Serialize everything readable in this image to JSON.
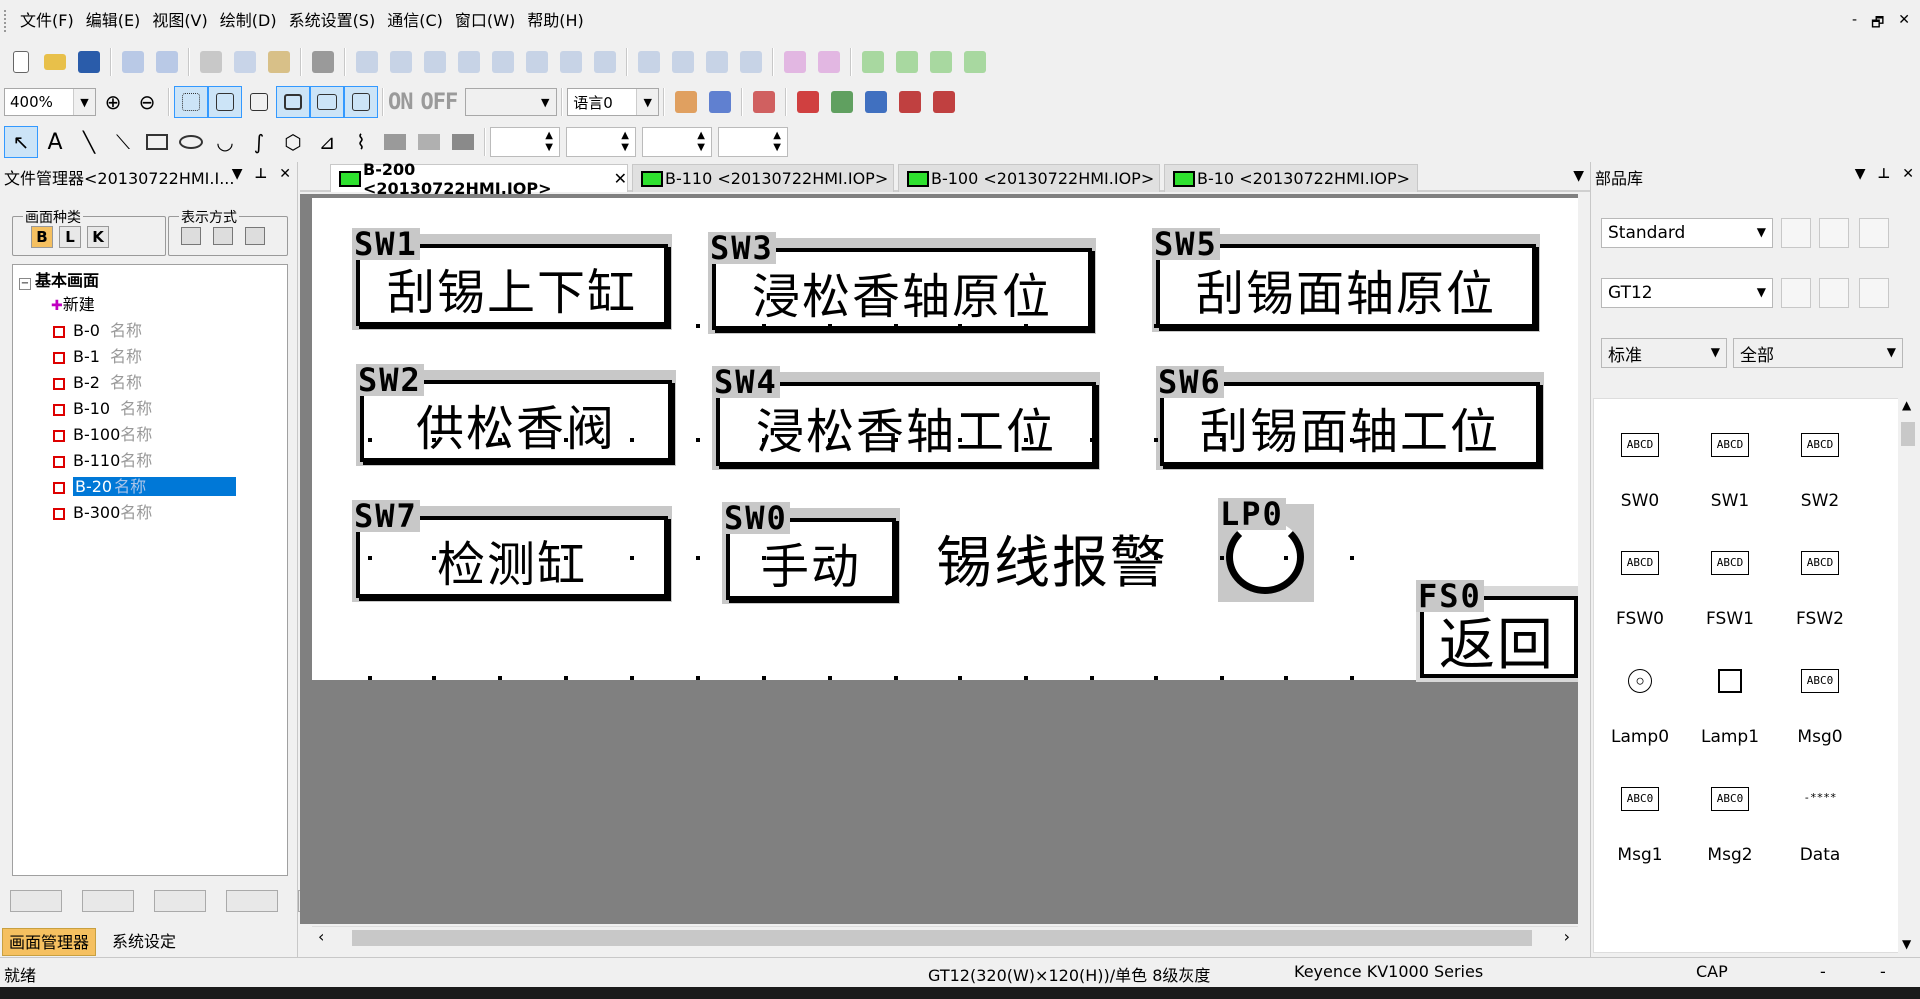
{
  "menu": [
    "文件(F)",
    "编辑(E)",
    "视图(V)",
    "绘制(D)",
    "系统设置(S)",
    "通信(C)",
    "窗口(W)",
    "帮助(H)"
  ],
  "window_controls": [
    "-",
    "🗗",
    "✕"
  ],
  "toolbar2": {
    "zoom": "400%",
    "on_label": "ON",
    "off_label": "OFF",
    "lang": "语言0"
  },
  "left_panel": {
    "title": "文件管理器<20130722HMI.I...",
    "group1_title": "画面种类",
    "group1_buttons": [
      "B",
      "L",
      "K"
    ],
    "group2_title": "表示方式",
    "tree_root": "基本画面",
    "tree_new": "新建",
    "tree_items": [
      {
        "id": "B-0",
        "name": "名称"
      },
      {
        "id": "B-1",
        "name": "名称"
      },
      {
        "id": "B-2",
        "name": "名称"
      },
      {
        "id": "B-10",
        "name": "名称"
      },
      {
        "id": "B-100",
        "name": "名称"
      },
      {
        "id": "B-110",
        "name": "名称"
      },
      {
        "id": "B-20",
        "name": "名称"
      },
      {
        "id": "B-300",
        "name": "名称"
      }
    ],
    "selected_item": "B-20",
    "tab_screens": "画面管理器",
    "tab_system": "系统设定"
  },
  "doc_tabs": [
    {
      "label": "B-200 <20130722HMI.IOP>",
      "active": true
    },
    {
      "label": "B-110 <20130722HMI.IOP>",
      "active": false
    },
    {
      "label": "B-100 <20130722HMI.IOP>",
      "active": false
    },
    {
      "label": "B-10 <20130722HMI.IOP>",
      "active": false
    }
  ],
  "hmi": {
    "sw1": {
      "tag": "SW1",
      "text": "刮锡上下缸"
    },
    "sw3": {
      "tag": "SW3",
      "text": "浸松香轴原位"
    },
    "sw5": {
      "tag": "SW5",
      "text": "刮锡面轴原位"
    },
    "sw2": {
      "tag": "SW2",
      "text": "供松香阀"
    },
    "sw4": {
      "tag": "SW4",
      "text": "浸松香轴工位"
    },
    "sw6": {
      "tag": "SW6",
      "text": "刮锡面轴工位"
    },
    "sw7": {
      "tag": "SW7",
      "text": "检测缸"
    },
    "sw0": {
      "tag": "SW0",
      "text": "手动"
    },
    "alarm_text": "锡线报警",
    "lp0": {
      "tag": "LP0"
    },
    "fs0": {
      "tag": "FS0",
      "text": "返回"
    }
  },
  "right_panel": {
    "title": "部品库",
    "combo1": "Standard",
    "combo2": "GT12",
    "combo3": "标准",
    "combo4": "全部",
    "parts": [
      {
        "label": "SW0",
        "pic": "ABCD"
      },
      {
        "label": "SW1",
        "pic": "ABCD"
      },
      {
        "label": "SW2",
        "pic": "ABCD"
      },
      {
        "label": "FSW0",
        "pic": "ABCD"
      },
      {
        "label": "FSW1",
        "pic": "ABCD"
      },
      {
        "label": "FSW2",
        "pic": "ABCD"
      },
      {
        "label": "Lamp0",
        "pic": "◯"
      },
      {
        "label": "Lamp1",
        "pic": "□"
      },
      {
        "label": "Msg0",
        "pic": "ABC0"
      },
      {
        "label": "Msg1",
        "pic": "ABC0"
      },
      {
        "label": "Msg2",
        "pic": "ABC0"
      },
      {
        "label": "Data",
        "pic": "-****"
      }
    ]
  },
  "status": {
    "ready": "就绪",
    "device": "GT12(320(W)×120(H))/单色 8级灰度",
    "plc": "Keyence KV1000 Series",
    "cap": "CAP",
    "s1": "-",
    "s2": "-"
  }
}
